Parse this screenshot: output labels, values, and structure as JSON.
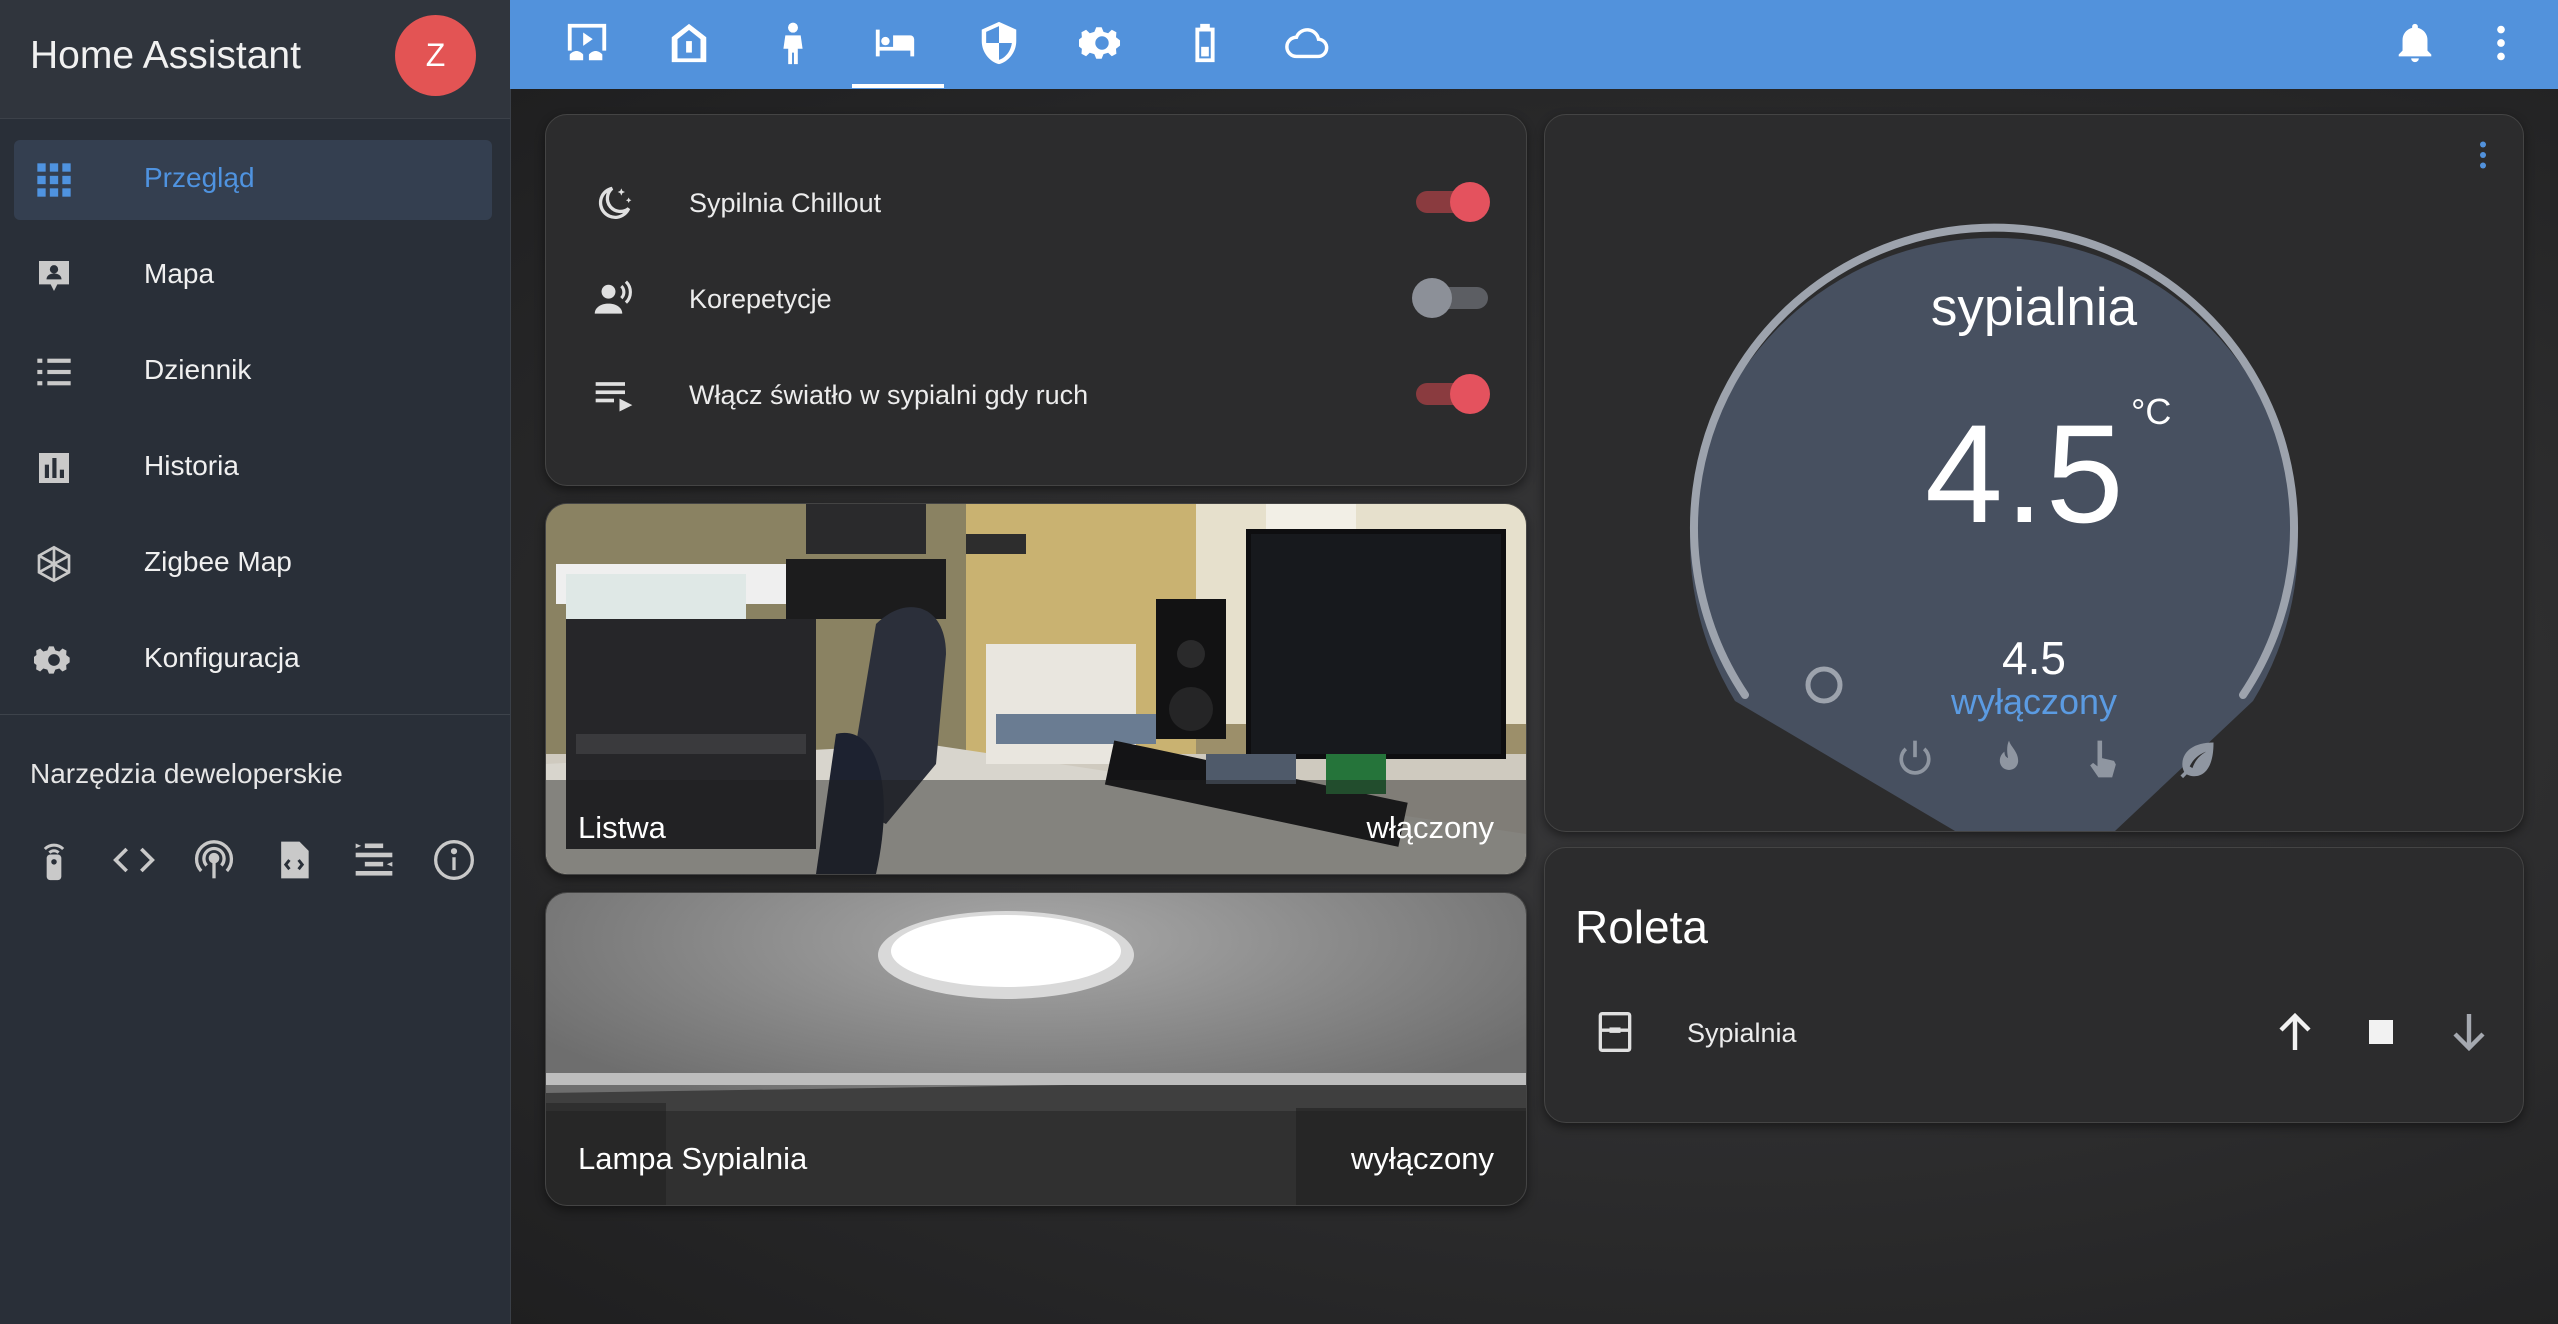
{
  "sidebar": {
    "title": "Home Assistant",
    "avatar_initial": "Z",
    "items": [
      {
        "label": "Przegląd",
        "icon": "grid-icon",
        "active": true
      },
      {
        "label": "Mapa",
        "icon": "map-account-icon"
      },
      {
        "label": "Dziennik",
        "icon": "list-icon"
      },
      {
        "label": "Historia",
        "icon": "chart-bar-icon"
      },
      {
        "label": "Zigbee Map",
        "icon": "hexagon-network-icon"
      },
      {
        "label": "Konfiguracja",
        "icon": "gear-icon"
      }
    ],
    "dev_tools_title": "Narzędzia deweloperskie",
    "dev_tools_icons": [
      "remote-icon",
      "code-icon",
      "broadcast-icon",
      "file-code-icon",
      "template-icon",
      "info-icon"
    ]
  },
  "topbar": {
    "tabs": [
      "media-icon",
      "home-icon",
      "person-icon",
      "bed-icon",
      "shield-icon",
      "gear-icon",
      "battery-icon",
      "cloud-icon"
    ],
    "active_tab": 3,
    "accent": "#5292dc"
  },
  "entities_card": {
    "rows": [
      {
        "label": "Sypilnia Chillout",
        "icon": "moon-stars-icon",
        "state": "on"
      },
      {
        "label": "Korepetycje",
        "icon": "account-voice-icon",
        "state": "off"
      },
      {
        "label": "Włącz światło w sypialni gdy ruch",
        "icon": "playlist-play-icon",
        "state": "on"
      }
    ]
  },
  "picture_cards": [
    {
      "name": "Listwa",
      "state": "włączony"
    },
    {
      "name": "Lampa Sypialnia",
      "state": "wyłączony"
    }
  ],
  "thermostat": {
    "name": "sypialnia",
    "current_temp": "4.5",
    "unit": "°C",
    "target_temp": "4.5",
    "hvac_state": "wyłączony",
    "modes": [
      "power-icon",
      "fire-icon",
      "hand-pointer-icon",
      "leaf-icon"
    ]
  },
  "cover_card": {
    "title": "Roleta",
    "entity": "Sypialnia",
    "buttons": [
      "arrow-up-icon",
      "stop-icon",
      "arrow-down-icon"
    ]
  },
  "colors": {
    "toggle_on": "#e4525e",
    "active_nav_text": "#4f93e0",
    "thermostat_state": "#5b9be2"
  }
}
